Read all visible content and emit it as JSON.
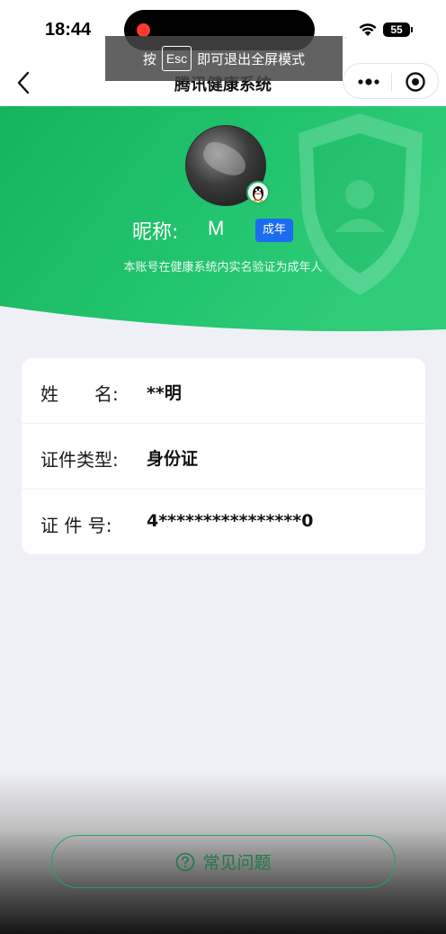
{
  "status_bar": {
    "time": "18:44",
    "signal_dots": "....",
    "battery": "55"
  },
  "overlay": {
    "press": "按",
    "key": "Esc",
    "message": "即可退出全屏模式"
  },
  "nav": {
    "title": "腾讯健康系统",
    "back_icon": "chevron-left-icon",
    "more_icon": "more-dots-icon",
    "close_icon": "target-circle-icon"
  },
  "profile": {
    "nickname_label": "昵称:",
    "nickname_value": "M",
    "adult_badge": "成年",
    "verification_note": "本账号在健康系统内实名验证为成年人"
  },
  "info": {
    "rows": [
      {
        "label": "姓　　名:",
        "value": "**明"
      },
      {
        "label": "证件类型:",
        "value": "身份证"
      },
      {
        "label": "证 件 号:",
        "value": "4****************0"
      }
    ]
  },
  "faq": {
    "label": "常见问题",
    "icon": "question-circle-icon"
  },
  "colors": {
    "hero_green": "#1fbf6a",
    "accent_blue": "#1c6cf1",
    "page_bg": "#eff0f5"
  }
}
